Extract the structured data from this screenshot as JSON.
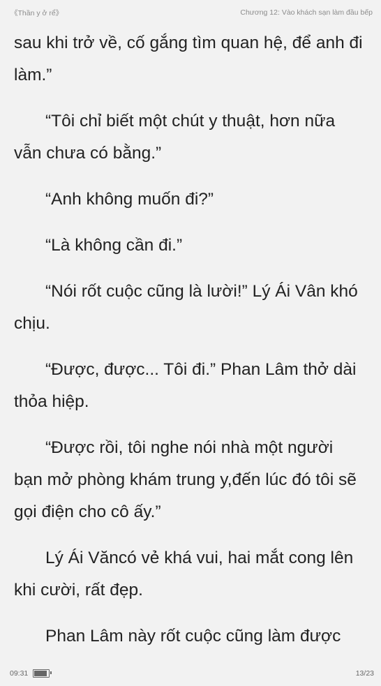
{
  "header": {
    "book_title": "《Thần y ở rể》",
    "chapter_title": "Chương 12: Vào khách sạn làm đầu bếp"
  },
  "paragraphs": [
    {
      "lines": [
        "sau khi trở về, cố gắng tìm quan hệ, để anh đi",
        "làm.”"
      ]
    },
    {
      "lines": [
        "“Tôi chỉ biết một chút y thuật, hơn nữa",
        "vẫn chưa có bằng.”"
      ]
    },
    {
      "lines": [
        "“Anh không muốn đi?”"
      ]
    },
    {
      "lines": [
        "“Là không cần đi.”"
      ]
    },
    {
      "lines": [
        "“Nói rốt cuộc cũng là lười!” Lý Ái Vân khó",
        "chịu."
      ]
    },
    {
      "lines": [
        "“Được, được... Tôi đi.” Phan Lâm thở dài",
        "thỏa hiệp."
      ]
    },
    {
      "lines": [
        "“Được rồi, tôi nghe nói nhà một người",
        "bạn mở phòng khám trung y,đến lúc đó tôi sẽ",
        "gọi điện cho cô ấy.”"
      ]
    },
    {
      "lines": [
        "Lý Ái Văncó vẻ khá vui, hai mắt cong lên",
        "khi cười, rất đẹp."
      ]
    },
    {
      "lines": [
        "Phan Lâm này rốt cuộc cũng làm được"
      ]
    }
  ],
  "footer": {
    "time": "09:31",
    "battery_level": 0.9,
    "page_indicator": "13/23"
  },
  "colors": {
    "background": "#f2f2f2",
    "text": "#222222",
    "header_text": "#8c8c8c"
  }
}
